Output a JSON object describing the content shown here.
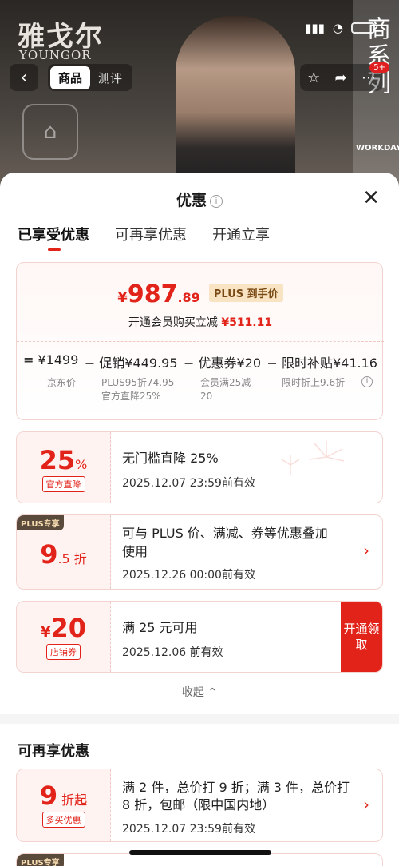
{
  "header": {
    "brand_cn": "雅戈尔",
    "brand_en": "YOUNGOR",
    "tabs": [
      "商品",
      "测评"
    ],
    "side_text": "商系列",
    "workday": "WORKDAY",
    "badge": "5+",
    "back": "‹",
    "icons": [
      "star-icon",
      "share-icon",
      "more-icon"
    ]
  },
  "sheet": {
    "title": "优惠",
    "info": "i",
    "close": "✕",
    "tabs": [
      "已享受优惠",
      "可再享优惠",
      "开通立享"
    ]
  },
  "summary": {
    "price_symbol": "¥",
    "price_int": "987",
    "price_dec": ".89",
    "plus_tag": "PLUS 到手价",
    "member_text": "开通会员购买立减",
    "member_amount": "¥511.11",
    "calc": [
      {
        "op": "=",
        "label": "¥1499",
        "sub": [
          "京东价"
        ]
      },
      {
        "op": "−",
        "label": "促销¥449.95",
        "sub": [
          "PLUS95折74.95",
          "官方直降25%"
        ]
      },
      {
        "op": "−",
        "label": "优惠券¥20",
        "sub": [
          "会员满25减",
          "20"
        ]
      },
      {
        "op": "−",
        "label": "限时补贴¥41.16",
        "sub": [
          "限时折上9.6折"
        ]
      }
    ]
  },
  "cards": [
    {
      "big": "25",
      "unit": "%",
      "tag": "官方直降",
      "line1": "无门槛直降 25%",
      "line2": "2025.12.07 23:59前有效"
    },
    {
      "corner": "PLUS专享",
      "big": "9",
      "unit": ".5 折",
      "line1": "可与 PLUS 价、满减、券等优惠叠加",
      "line1b": "使用",
      "line2": "2025.12.26 00:00前有效",
      "chev": "›"
    },
    {
      "prefix": "¥",
      "big": "20",
      "tag": "店铺券",
      "line1": "满 25 元可用",
      "line2": "2025.12.06 前有效",
      "claim": "开通领取"
    }
  ],
  "collapse": "收起 ⌃",
  "more_section": {
    "title": "可再享优惠",
    "card": {
      "big": "9",
      "unit": " 折起",
      "tag": "多买优惠",
      "line1": "满 2 件，总价打 9 折；满 3 件，总价打",
      "line1b": "8 折，包邮（限中国内地）",
      "line2": "2025.12.07 23:59前有效",
      "chev": "›"
    },
    "next_corner": "PLUS专享"
  },
  "colors": {
    "accent": "#e2231a",
    "plus_bg": "#f8e3c3"
  }
}
